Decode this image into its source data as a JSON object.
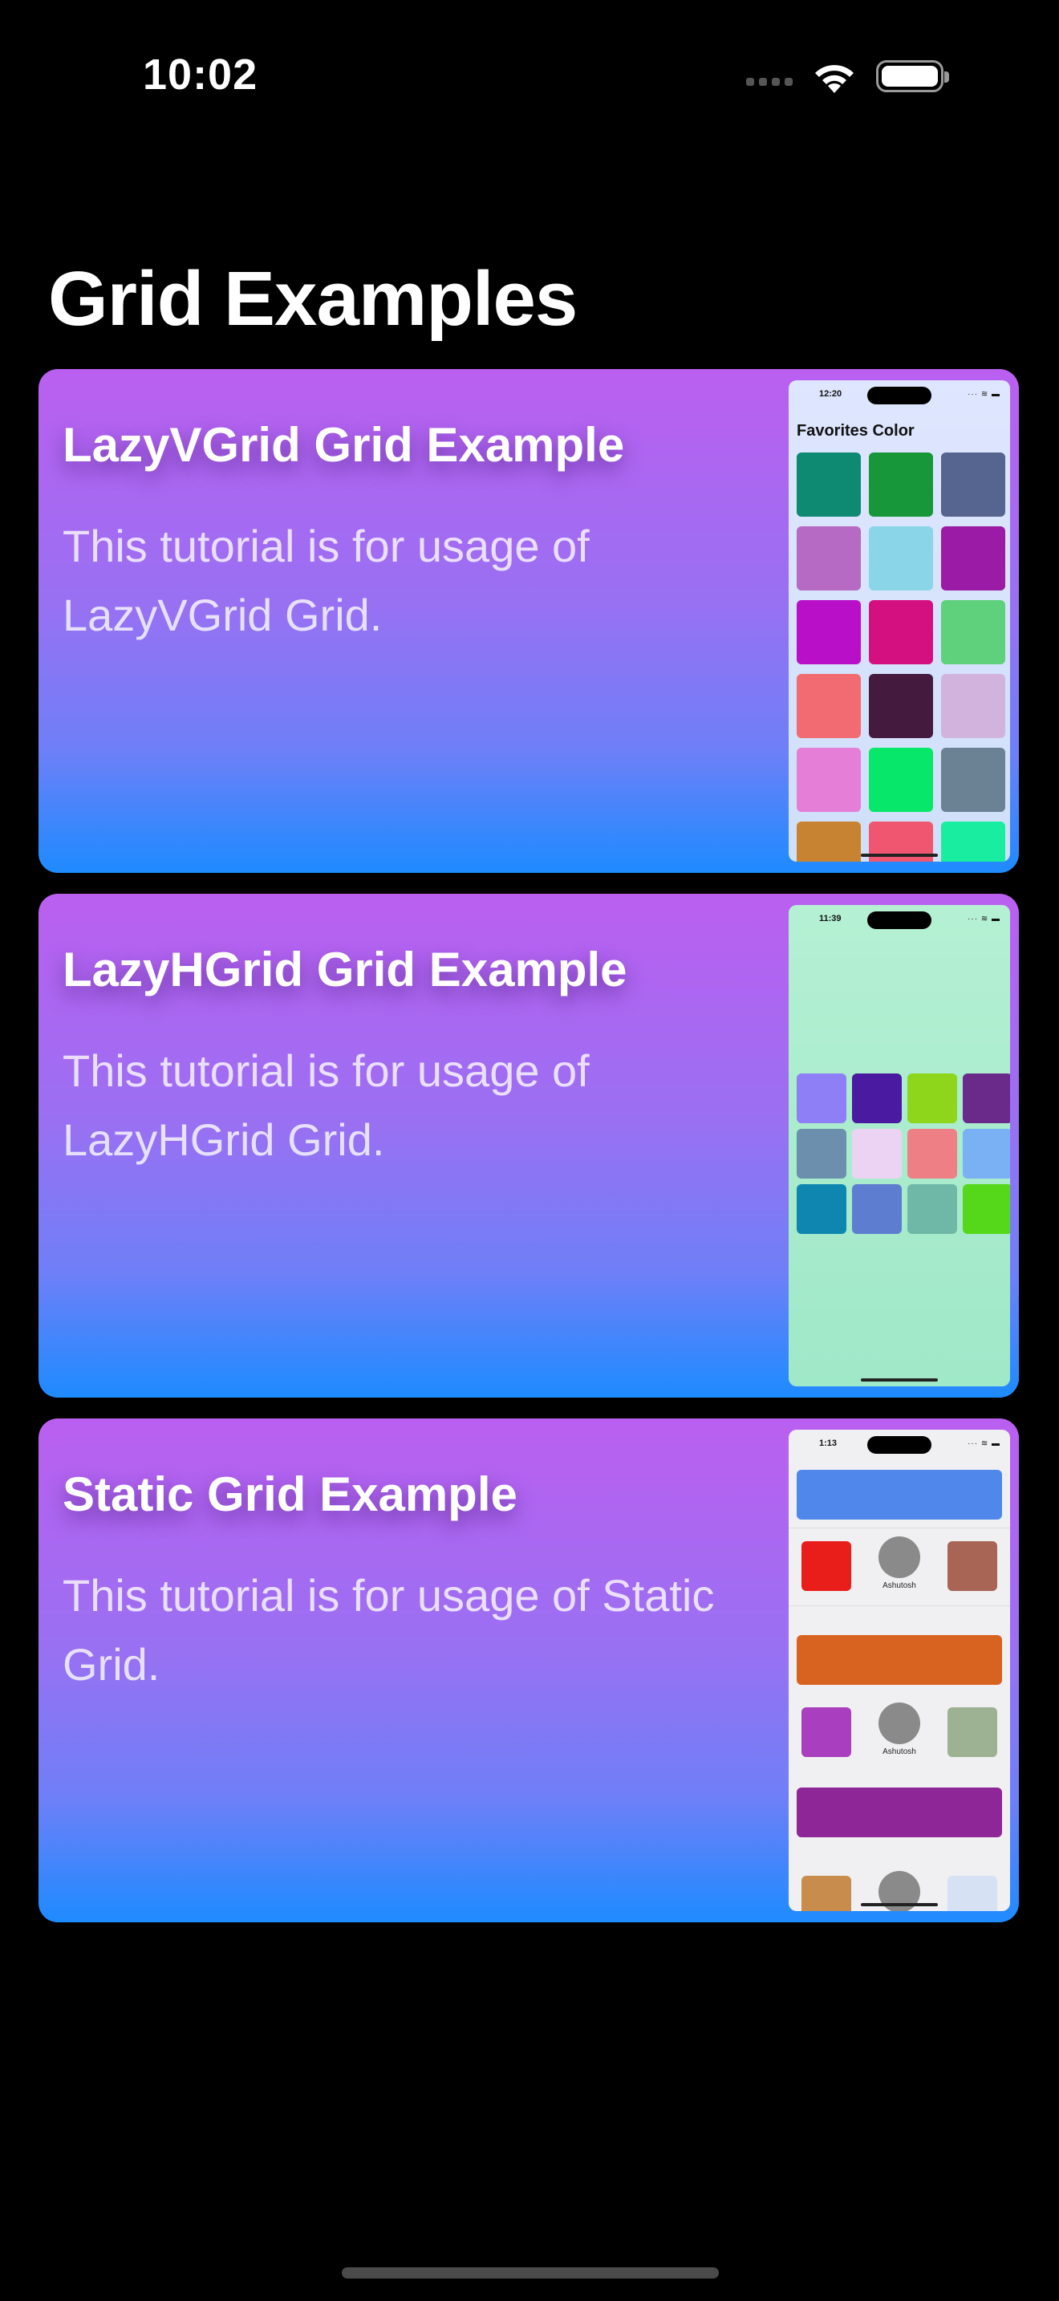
{
  "status_bar": {
    "time": "10:02",
    "wifi_icon": "wifi-icon",
    "battery_icon": "battery-icon"
  },
  "page": {
    "title": "Grid Examples"
  },
  "cards": [
    {
      "title": "LazyVGrid Grid Example",
      "description": "This tutorial is for usage of LazyVGrid Grid.",
      "preview": {
        "time": "12:20",
        "heading": "Favorites Color",
        "swatches": [
          "#0f8a72",
          "#17963a",
          "#56658f",
          "#b66ac4",
          "#8ad6e8",
          "#9b1aa6",
          "#b90fc9",
          "#d40f80",
          "#5fd07c",
          "#f36b72",
          "#451a3f",
          "#d2b3de",
          "#e57ed6",
          "#07e86a",
          "#6a8293",
          "#c88332",
          "#f0566f",
          "#19eea0"
        ]
      }
    },
    {
      "title": "LazyHGrid Grid Example",
      "description": "This tutorial is for usage of LazyHGrid Grid.",
      "preview": {
        "time": "11:39",
        "swatches": [
          "#8f7ff7",
          "#4a1aa0",
          "#8ed61c",
          "#6a2a8a",
          "#6c8fae",
          "#ecd3f4",
          "#ee7f84",
          "#7ab0f4",
          "#0f86b0",
          "#5c7dd0",
          "#6fb8a8",
          "#55d81a"
        ]
      }
    },
    {
      "title": "Static Grid Example",
      "description": "This tutorial is for usage of Static Grid.",
      "preview": {
        "time": "1:13",
        "avatar_name_1": "Ashutosh",
        "avatar_name_2": "Ashutosh",
        "bar_colors": [
          "#4f88ea",
          "#d8621f",
          "#8e2698"
        ],
        "row1_colors": [
          "#e91e1a",
          "#a86454"
        ],
        "row2_colors": [
          "#a93fbf",
          "#9cb292"
        ],
        "row3_colors": [
          "#c88d4c",
          "#d6e2f4"
        ]
      }
    }
  ]
}
